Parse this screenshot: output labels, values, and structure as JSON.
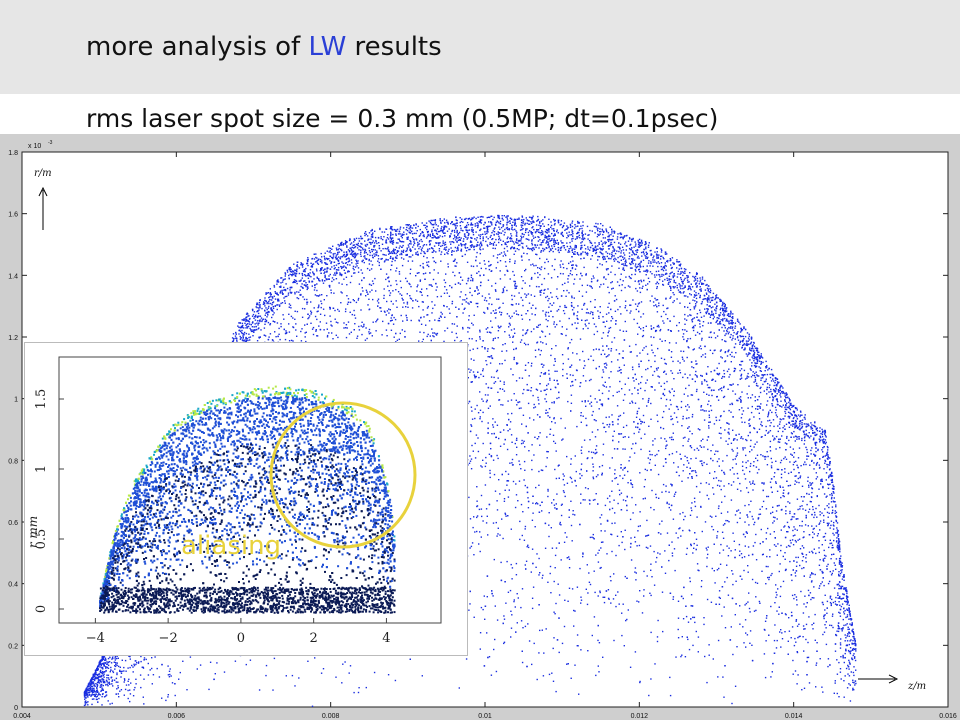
{
  "slide": {
    "title_prefix": "more analysis of ",
    "title_highlight": "LW",
    "title_suffix": " results",
    "subtitle": "rms laser spot size = 0.3 mm   (0.5MP; dt=0.1psec)",
    "highlight_color": "#2a3fd6"
  },
  "chart_data": [
    {
      "type": "scatter",
      "title": "",
      "xlabel": "z/m",
      "ylabel": "r/m",
      "y_exponent_label": "x 10",
      "y_exponent_power": "-3",
      "xlim": [
        0.004,
        0.016
      ],
      "ylim": [
        0,
        1.8
      ],
      "x_ticks": [
        0.004,
        0.006,
        0.008,
        0.01,
        0.012,
        0.014,
        0.016
      ],
      "x_tick_labels": [
        "0.004",
        "0.006",
        "0.008",
        "0.01",
        "0.012",
        "0.014",
        "0.016"
      ],
      "y_ticks": [
        0,
        0.2,
        0.4,
        0.6,
        0.8,
        1,
        1.2,
        1.4,
        1.6,
        1.8
      ],
      "y_tick_labels": [
        "0",
        "0.2",
        "0.4",
        "0.6",
        "0.8",
        "1",
        "1.2",
        "1.4",
        "1.6",
        "1.8"
      ],
      "grid": false,
      "point_color": "#1a2ee0",
      "envelope": {
        "x": [
          0.0048,
          0.0058,
          0.0062,
          0.0068,
          0.0075,
          0.0085,
          0.0095,
          0.0105,
          0.0115,
          0.0122,
          0.0128,
          0.0134,
          0.014,
          0.0144,
          0.0145,
          0.0146,
          0.0148,
          0.0148
        ],
        "r_top": [
          0.05,
          0.55,
          0.95,
          1.25,
          1.44,
          1.55,
          1.59,
          1.6,
          1.57,
          1.5,
          1.4,
          1.22,
          0.98,
          0.9,
          0.75,
          0.5,
          0.2,
          0.05
        ]
      }
    },
    {
      "type": "scatter",
      "title": "",
      "xlabel": "",
      "ylabel": "r mm",
      "xlim": [
        -5,
        5.5
      ],
      "ylim": [
        -0.1,
        1.8
      ],
      "x_ticks": [
        -4,
        -2,
        0,
        2,
        4
      ],
      "x_tick_labels": [
        "−4",
        "−2",
        "0",
        "2",
        "4"
      ],
      "y_ticks": [
        0,
        0.5,
        1,
        1.5
      ],
      "y_tick_labels": [
        "0",
        "0.5",
        "1",
        "1.5"
      ],
      "grid": false,
      "annotation": "aliasing",
      "annotation_color": "#e8d23c",
      "colors": [
        "#0b1a55",
        "#1f4fd6",
        "#19a8c8",
        "#b7e84a"
      ],
      "envelope": {
        "x": [
          -3.9,
          -3.5,
          -3.0,
          -2.0,
          -1.0,
          0.0,
          1.0,
          2.0,
          3.0,
          3.5,
          3.8,
          4.1,
          4.2
        ],
        "r_top": [
          0.08,
          0.55,
          0.9,
          1.3,
          1.48,
          1.57,
          1.6,
          1.57,
          1.45,
          1.32,
          1.1,
          0.8,
          0.5
        ]
      }
    }
  ]
}
